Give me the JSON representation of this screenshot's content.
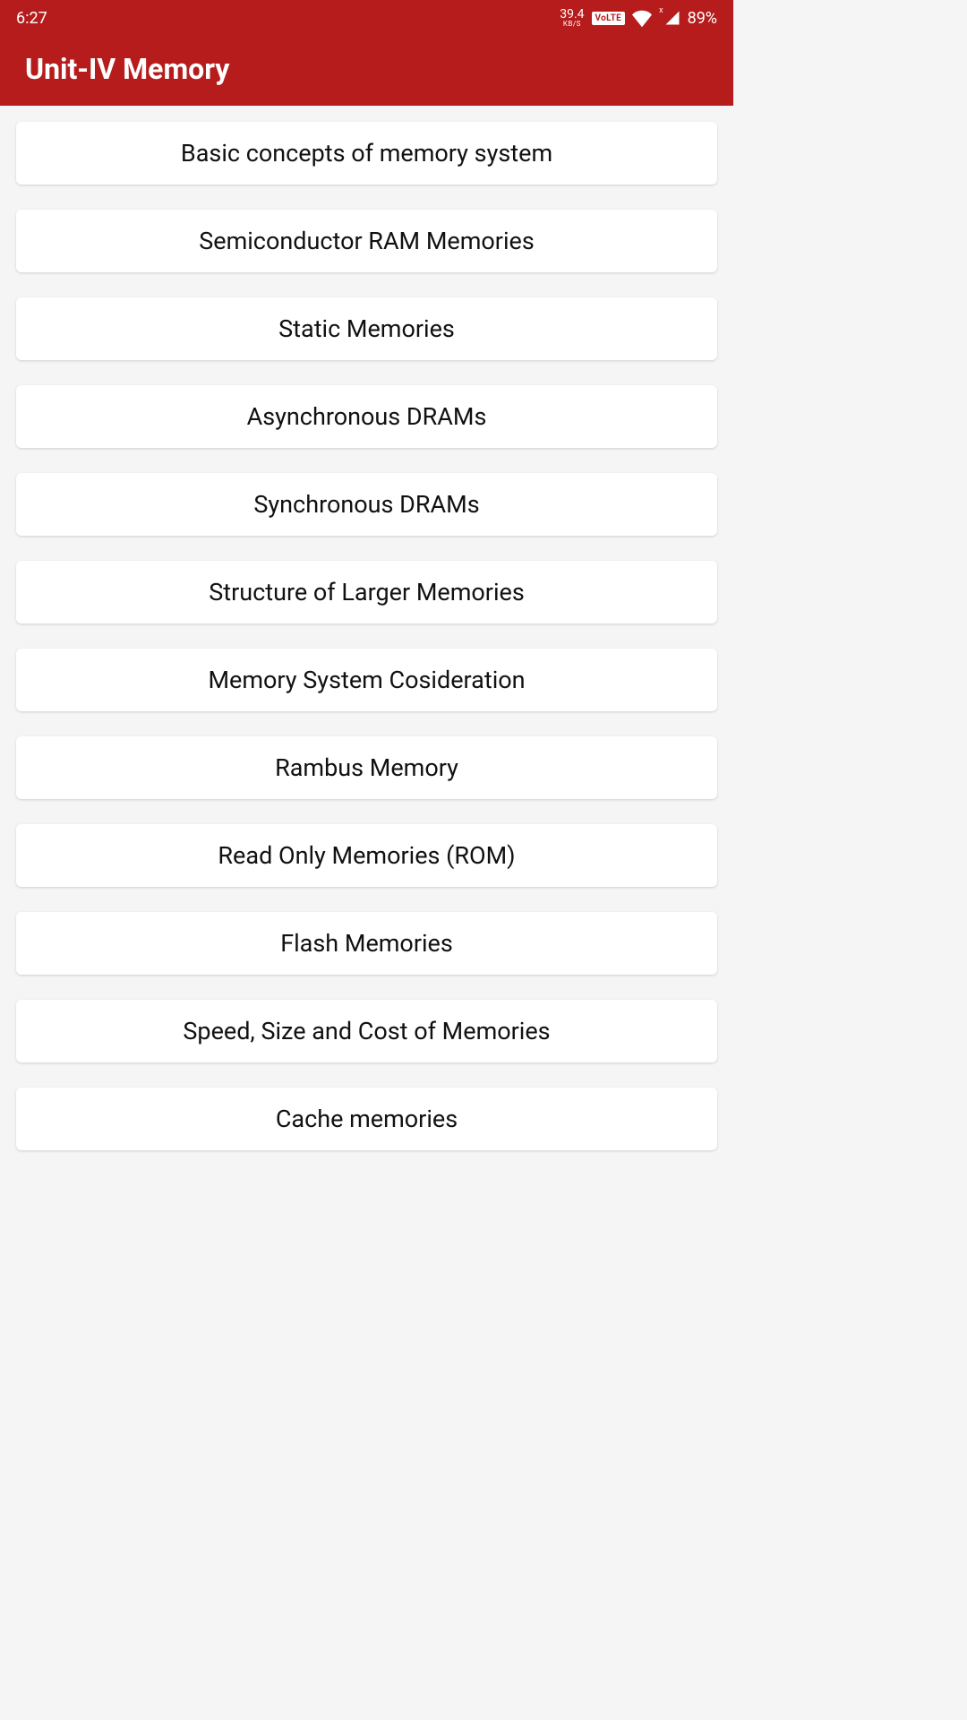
{
  "status_bar": {
    "time": "6:27",
    "kbs_value": "39.4",
    "kbs_label": "KB/S",
    "volte": "VoLTE",
    "signal_x": "x",
    "battery": "89%"
  },
  "header": {
    "title": "Unit-IV Memory"
  },
  "topics": [
    {
      "label": "Basic concepts of memory system"
    },
    {
      "label": "Semiconductor RAM Memories"
    },
    {
      "label": "Static Memories"
    },
    {
      "label": "Asynchronous DRAMs"
    },
    {
      "label": "Synchronous DRAMs"
    },
    {
      "label": "Structure of Larger Memories"
    },
    {
      "label": "Memory System Cosideration"
    },
    {
      "label": "Rambus Memory"
    },
    {
      "label": "Read Only Memories (ROM)"
    },
    {
      "label": "Flash Memories"
    },
    {
      "label": "Speed, Size and Cost of Memories"
    },
    {
      "label": "Cache memories"
    }
  ]
}
